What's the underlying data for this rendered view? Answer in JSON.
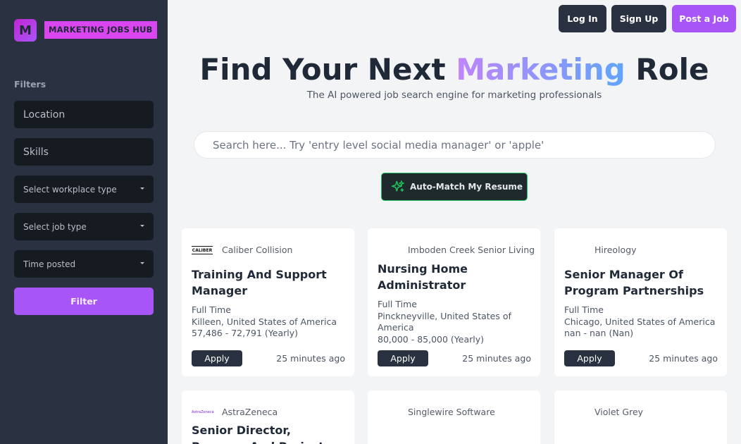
{
  "brand": {
    "logo_letter": "M",
    "name": "MARKETING JOBS HUB"
  },
  "filters": {
    "title": "Filters",
    "location_placeholder": "Location",
    "skills_placeholder": "Skills",
    "workplace_type": "Select workplace type",
    "job_type": "Select job type",
    "time_posted": "Time posted",
    "button": "Filter"
  },
  "header": {
    "login": "Log In",
    "signup": "Sign Up",
    "post_job": "Post a Job"
  },
  "hero": {
    "title_before": "Find Your Next ",
    "title_accent": "Marketing",
    "title_after": " Role",
    "subtitle": "The AI powered job search engine for marketing professionals"
  },
  "search": {
    "placeholder": "Search here... Try 'entry level social media manager' or 'apple'"
  },
  "automatch": {
    "label": "Auto-Match My Resume",
    "icon": "sparkles-icon"
  },
  "jobs": [
    {
      "company": "Caliber Collision",
      "logo_text": "CALIBER",
      "title": "Training And Support Manager",
      "type": "Full Time",
      "location": "Killeen, United States of America",
      "salary": "57,486 - 72,791 (Yearly)",
      "apply": "Apply",
      "posted": "25 minutes ago"
    },
    {
      "company": "Imboden Creek Senior Living",
      "title": "Nursing Home Administrator",
      "type": "Full Time",
      "location": "Pinckneyville, United States of America",
      "salary": "80,000 - 85,000 (Yearly)",
      "apply": "Apply",
      "posted": "25 minutes ago"
    },
    {
      "company": "Hireology",
      "title": "Senior Manager Of Program Partnerships",
      "type": "Full Time",
      "location": "Chicago, United States of America",
      "salary": "nan - nan (Nan)",
      "apply": "Apply",
      "posted": "25 minutes ago"
    },
    {
      "company": "AstraZeneca",
      "logo_text": "AstraZeneca",
      "title": "Senior Director, Program And Project"
    },
    {
      "company": "Singlewire Software"
    },
    {
      "company": "Violet Grey"
    }
  ],
  "colors": {
    "accent": "#a855f7",
    "sidebar": "#2a3140",
    "automatch_border": "#22c55e"
  }
}
